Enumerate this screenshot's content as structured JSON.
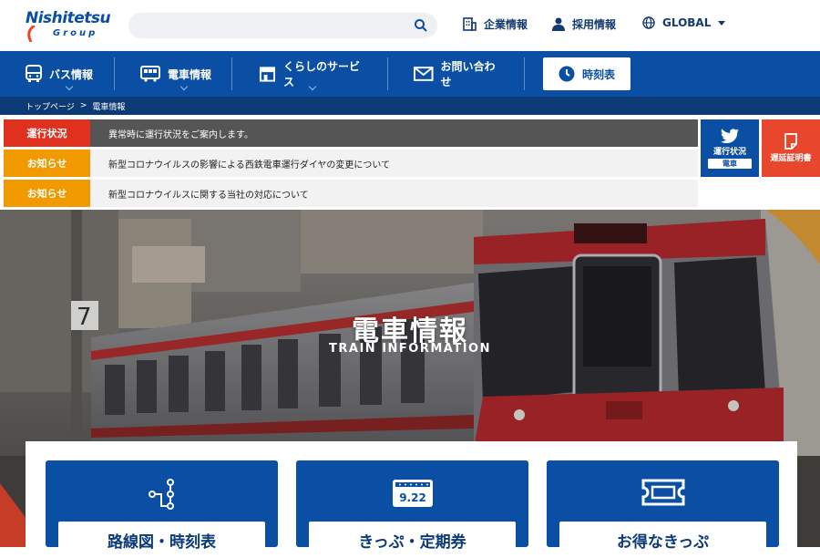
{
  "header": {
    "logo": {
      "main": "Nishitetsu",
      "sub": "Group"
    },
    "search": {
      "placeholder": ""
    },
    "links": [
      {
        "label": "企業情報",
        "icon": "building-icon"
      },
      {
        "label": "採用情報",
        "icon": "person-icon"
      },
      {
        "label": "GLOBAL",
        "icon": "globe-icon"
      }
    ]
  },
  "nav": {
    "items": [
      {
        "label": "バス情報",
        "icon": "bus-icon"
      },
      {
        "label": "電車情報",
        "icon": "train-icon"
      },
      {
        "label": "くらしのサービス",
        "icon": "shop-icon"
      },
      {
        "label": "お問い合わせ",
        "icon": "mail-icon"
      }
    ],
    "timetable_label": "時刻表"
  },
  "breadcrumb": {
    "home": "トップページ",
    "separator": ">",
    "current": "電車情報"
  },
  "notices": [
    {
      "tag": "運行状況",
      "text": "異常時に運行状況をご案内します。",
      "tag_color": "#e0311f",
      "bg": "#555555",
      "text_color": "#ffffff"
    },
    {
      "tag": "お知らせ",
      "text": "新型コロナウイルスの影響による西鉄電車運行ダイヤの変更について",
      "tag_color": "#f09a00",
      "bg": "#f2f2f2",
      "text_color": "#222222"
    },
    {
      "tag": "お知らせ",
      "text": "新型コロナウイルスに関する当社の対応について",
      "tag_color": "#f09a00",
      "bg": "#f2f2f2",
      "text_color": "#222222"
    }
  ],
  "side_buttons": {
    "twitter": {
      "label": "運行状況",
      "sub": "電車",
      "color": "#0a4fa3"
    },
    "delay": {
      "label": "遅延証明書",
      "color": "#e8472e"
    }
  },
  "hero": {
    "title": "電車情報",
    "subtitle": "TRAIN INFORMATION"
  },
  "cards": [
    {
      "label": "路線図・時刻表",
      "icon": "route-map-icon"
    },
    {
      "label": "きっぷ・定期券",
      "icon": "ticket-date-icon",
      "icon_text": "9.22"
    },
    {
      "label": "お得なきっぷ",
      "icon": "ticket-icon"
    }
  ],
  "colors": {
    "brand": "#0a4fa3",
    "breadcrumb": "#0c3a74",
    "alert": "#e0311f",
    "notice": "#f09a00"
  }
}
